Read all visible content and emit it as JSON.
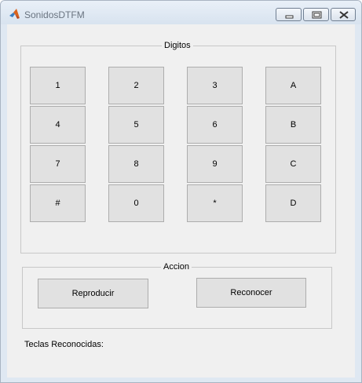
{
  "window": {
    "title": "SonidosDTFM",
    "minimize_icon": "minimize-icon",
    "maximize_icon": "maximize-icon",
    "close_icon": "close-icon",
    "app_icon": "matlab-icon"
  },
  "digits_panel": {
    "title": "Digitos",
    "keys": [
      "1",
      "2",
      "3",
      "A",
      "4",
      "5",
      "6",
      "B",
      "7",
      "8",
      "9",
      "C",
      "#",
      "0",
      "*",
      "D"
    ]
  },
  "action_panel": {
    "title": "Accion",
    "play_label": "Reproducir",
    "recognize_label": "Reconocer"
  },
  "recognized": {
    "label": "Teclas Reconocidas:",
    "value": ""
  },
  "colors": {
    "client_bg": "#f0f0f0",
    "button_bg": "#e1e1e1",
    "button_border": "#adadad",
    "panel_border": "#c8c8c8"
  }
}
